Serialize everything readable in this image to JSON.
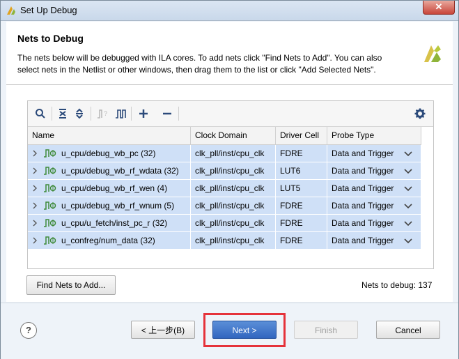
{
  "window": {
    "title": "Set Up Debug",
    "close_label": "✕"
  },
  "header": {
    "title": "Nets to Debug",
    "description": "The nets below will be debugged with ILA cores. To add nets click \"Find Nets to Add\". You can also select nets in the Netlist or other windows, then drag them to the list or click \"Add Selected Nets\"."
  },
  "toolbar": {
    "icons": [
      "search-icon",
      "collapse-all-icon",
      "expand-all-icon",
      "probe-icon",
      "waveform-icon",
      "add-icon",
      "remove-icon",
      "settings-icon"
    ]
  },
  "table": {
    "columns": [
      "Name",
      "Clock Domain",
      "Driver Cell",
      "Probe Type"
    ],
    "rows": [
      {
        "name": "u_cpu/debug_wb_pc (32)",
        "clock": "clk_pll/inst/cpu_clk",
        "driver": "FDRE",
        "probe": "Data and Trigger"
      },
      {
        "name": "u_cpu/debug_wb_rf_wdata (32)",
        "clock": "clk_pll/inst/cpu_clk",
        "driver": "LUT6",
        "probe": "Data and Trigger"
      },
      {
        "name": "u_cpu/debug_wb_rf_wen (4)",
        "clock": "clk_pll/inst/cpu_clk",
        "driver": "LUT5",
        "probe": "Data and Trigger"
      },
      {
        "name": "u_cpu/debug_wb_rf_wnum (5)",
        "clock": "clk_pll/inst/cpu_clk",
        "driver": "FDRE",
        "probe": "Data and Trigger"
      },
      {
        "name": "u_cpu/u_fetch/inst_pc_r (32)",
        "clock": "clk_pll/inst/cpu_clk",
        "driver": "FDRE",
        "probe": "Data and Trigger"
      },
      {
        "name": "u_confreg/num_data (32)",
        "clock": "clk_pll/inst/cpu_clk",
        "driver": "FDRE",
        "probe": "Data and Trigger"
      }
    ]
  },
  "actions": {
    "find_nets": "Find Nets to Add...",
    "nets_count": "Nets to debug: 137"
  },
  "footer": {
    "help": "?",
    "back": "< 上一步(B)",
    "next": "Next >",
    "finish": "Finish",
    "cancel": "Cancel"
  },
  "colors": {
    "row_selected": "#cfe0f7",
    "next_button": "#3a6fc9",
    "highlight_box": "#e5323a"
  }
}
